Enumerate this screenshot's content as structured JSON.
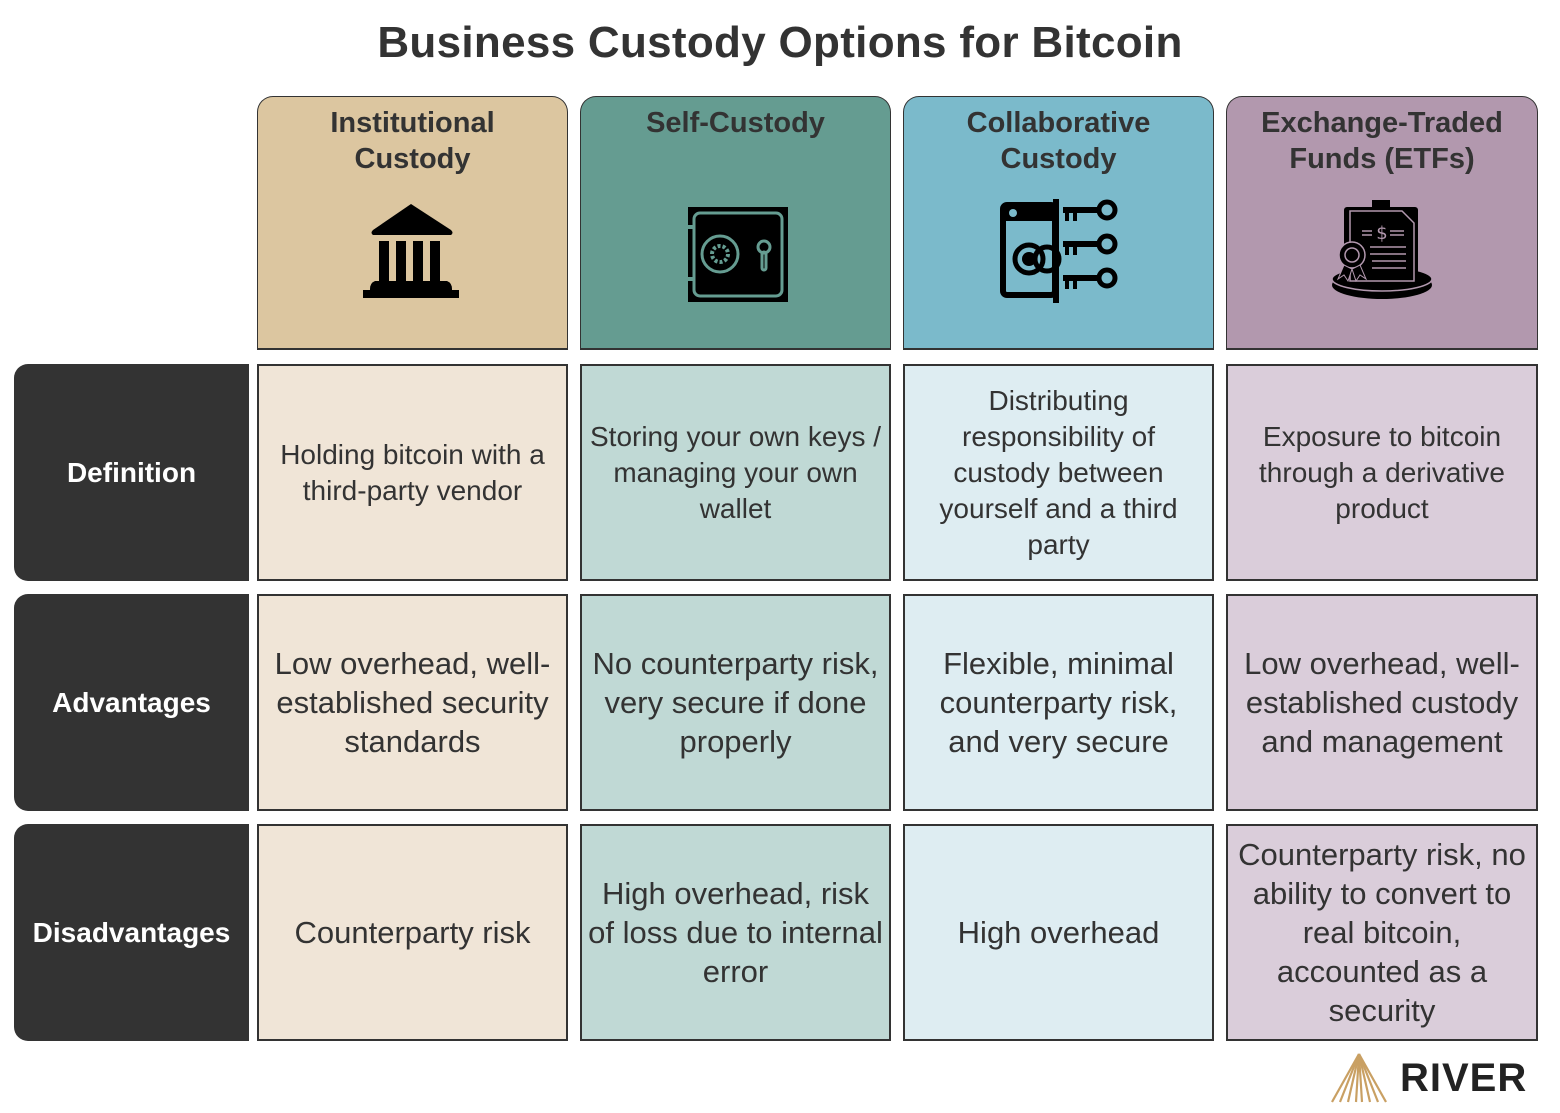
{
  "title": "Business Custody Options for Bitcoin",
  "columns": [
    {
      "label": "Institutional\nCustody",
      "icon": "bank-building-icon",
      "header_color": "#dcc6a0",
      "cell_color": "#f0e5d7"
    },
    {
      "label": "Self-Custody",
      "icon": "safe-icon",
      "header_color": "#659c91",
      "cell_color": "#c0d9d5"
    },
    {
      "label": "Collaborative\nCustody",
      "icon": "safe-keys-icon",
      "header_color": "#7bbacb",
      "cell_color": "#deedf2"
    },
    {
      "label": "Exchange-Traded\nFunds (ETFs)",
      "icon": "certificate-document-icon",
      "header_color": "#b298ae",
      "cell_color": "#dacdda"
    }
  ],
  "rows": [
    {
      "label": "Definition",
      "cells": [
        "Holding bitcoin with a third-party vendor",
        "Storing your own keys / managing your own wallet",
        "Distributing responsibility of custody between yourself and a third party",
        "Exposure to bitcoin through a derivative product"
      ]
    },
    {
      "label": "Advantages",
      "cells": [
        "Low overhead, well-established security standards",
        "No counterparty risk, very secure if done properly",
        "Flexible, minimal counterparty risk, and very secure",
        "Low overhead, well-established custody and management"
      ]
    },
    {
      "label": "Disadvantages",
      "cells": [
        "Counterparty risk",
        "High overhead, risk of loss due to internal error",
        "High overhead",
        "Counterparty risk, no ability to convert to real bitcoin, accounted as a security"
      ]
    }
  ],
  "brand": {
    "name": "RIVER",
    "accent": "#c9a063"
  }
}
